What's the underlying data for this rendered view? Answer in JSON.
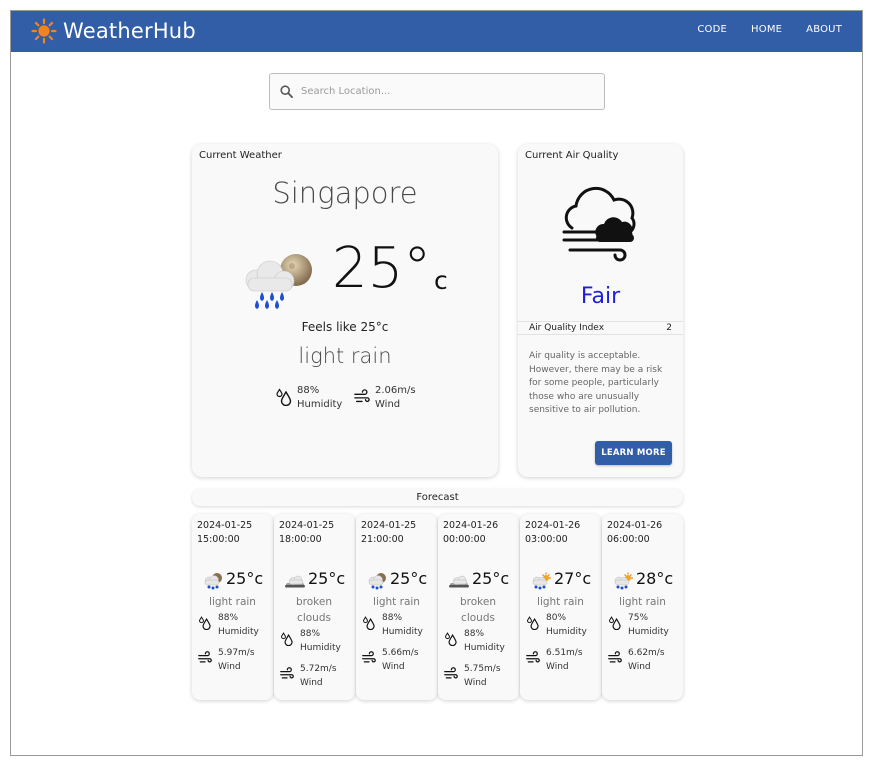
{
  "app": {
    "title": "WeatherHub",
    "nav": [
      "CODE",
      "HOME",
      "ABOUT"
    ]
  },
  "search": {
    "placeholder": "Search Location..."
  },
  "current": {
    "heading": "Current Weather",
    "city": "Singapore",
    "temp": "25°",
    "unit": "c",
    "feels_like": "Feels like 25°c",
    "description": "light rain",
    "humidity": "88%",
    "humidity_label": "Humidity",
    "wind": "2.06m/s",
    "wind_label": "Wind",
    "icon": "rain-cloud-moon-icon"
  },
  "air_quality": {
    "heading": "Current Air Quality",
    "label": "Fair",
    "label_color": "#1f1fd6",
    "index_label": "Air Quality Index",
    "index_value": "2",
    "description": "Air quality is acceptable. However, there may be a risk for some people, particularly those who are unusually sensitive to air pollution.",
    "button": "LEARN MORE",
    "icon": "haze-cloud-icon"
  },
  "forecast": {
    "heading": "Forecast",
    "items": [
      {
        "date": "2024-01-25",
        "time": "15:00:00",
        "temp": "25°c",
        "desc": "light rain",
        "humidity": "88%",
        "humidity_label": "Humidity",
        "wind": "5.97m/s",
        "wind_label": "Wind",
        "icon": "rain-moon-icon"
      },
      {
        "date": "2024-01-25",
        "time": "18:00:00",
        "temp": "25°c",
        "desc": "broken clouds",
        "humidity": "88%",
        "humidity_label": "Humidity",
        "wind": "5.72m/s",
        "wind_label": "Wind",
        "icon": "broken-clouds-icon"
      },
      {
        "date": "2024-01-25",
        "time": "21:00:00",
        "temp": "25°c",
        "desc": "light rain",
        "humidity": "88%",
        "humidity_label": "Humidity",
        "wind": "5.66m/s",
        "wind_label": "Wind",
        "icon": "rain-moon-icon"
      },
      {
        "date": "2024-01-26",
        "time": "00:00:00",
        "temp": "25°c",
        "desc": "broken clouds",
        "humidity": "88%",
        "humidity_label": "Humidity",
        "wind": "5.75m/s",
        "wind_label": "Wind",
        "icon": "broken-clouds-icon"
      },
      {
        "date": "2024-01-26",
        "time": "03:00:00",
        "temp": "27°c",
        "desc": "light rain",
        "humidity": "80%",
        "humidity_label": "Humidity",
        "wind": "6.51m/s",
        "wind_label": "Wind",
        "icon": "rain-sun-icon"
      },
      {
        "date": "2024-01-26",
        "time": "06:00:00",
        "temp": "28°c",
        "desc": "light rain",
        "humidity": "75%",
        "humidity_label": "Humidity",
        "wind": "6.62m/s",
        "wind_label": "Wind",
        "icon": "rain-sun-icon"
      }
    ]
  },
  "colors": {
    "header": "#325ea8",
    "sun": "#f5821f",
    "rain": "#1d4fd1"
  }
}
